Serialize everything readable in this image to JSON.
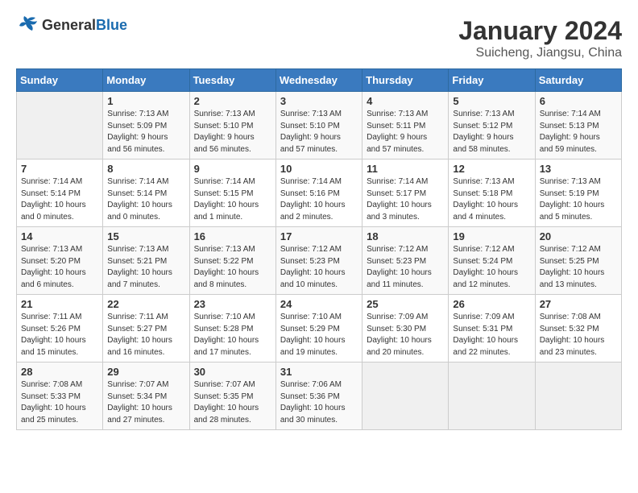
{
  "header": {
    "logo": {
      "general": "General",
      "blue": "Blue"
    },
    "title": "January 2024",
    "location": "Suicheng, Jiangsu, China"
  },
  "calendar": {
    "days_of_week": [
      "Sunday",
      "Monday",
      "Tuesday",
      "Wednesday",
      "Thursday",
      "Friday",
      "Saturday"
    ],
    "weeks": [
      [
        {
          "day": "",
          "info": ""
        },
        {
          "day": "1",
          "info": "Sunrise: 7:13 AM\nSunset: 5:09 PM\nDaylight: 9 hours\nand 56 minutes."
        },
        {
          "day": "2",
          "info": "Sunrise: 7:13 AM\nSunset: 5:10 PM\nDaylight: 9 hours\nand 56 minutes."
        },
        {
          "day": "3",
          "info": "Sunrise: 7:13 AM\nSunset: 5:10 PM\nDaylight: 9 hours\nand 57 minutes."
        },
        {
          "day": "4",
          "info": "Sunrise: 7:13 AM\nSunset: 5:11 PM\nDaylight: 9 hours\nand 57 minutes."
        },
        {
          "day": "5",
          "info": "Sunrise: 7:13 AM\nSunset: 5:12 PM\nDaylight: 9 hours\nand 58 minutes."
        },
        {
          "day": "6",
          "info": "Sunrise: 7:14 AM\nSunset: 5:13 PM\nDaylight: 9 hours\nand 59 minutes."
        }
      ],
      [
        {
          "day": "7",
          "info": "Sunrise: 7:14 AM\nSunset: 5:14 PM\nDaylight: 10 hours\nand 0 minutes."
        },
        {
          "day": "8",
          "info": "Sunrise: 7:14 AM\nSunset: 5:14 PM\nDaylight: 10 hours\nand 0 minutes."
        },
        {
          "day": "9",
          "info": "Sunrise: 7:14 AM\nSunset: 5:15 PM\nDaylight: 10 hours\nand 1 minute."
        },
        {
          "day": "10",
          "info": "Sunrise: 7:14 AM\nSunset: 5:16 PM\nDaylight: 10 hours\nand 2 minutes."
        },
        {
          "day": "11",
          "info": "Sunrise: 7:14 AM\nSunset: 5:17 PM\nDaylight: 10 hours\nand 3 minutes."
        },
        {
          "day": "12",
          "info": "Sunrise: 7:13 AM\nSunset: 5:18 PM\nDaylight: 10 hours\nand 4 minutes."
        },
        {
          "day": "13",
          "info": "Sunrise: 7:13 AM\nSunset: 5:19 PM\nDaylight: 10 hours\nand 5 minutes."
        }
      ],
      [
        {
          "day": "14",
          "info": "Sunrise: 7:13 AM\nSunset: 5:20 PM\nDaylight: 10 hours\nand 6 minutes."
        },
        {
          "day": "15",
          "info": "Sunrise: 7:13 AM\nSunset: 5:21 PM\nDaylight: 10 hours\nand 7 minutes."
        },
        {
          "day": "16",
          "info": "Sunrise: 7:13 AM\nSunset: 5:22 PM\nDaylight: 10 hours\nand 8 minutes."
        },
        {
          "day": "17",
          "info": "Sunrise: 7:12 AM\nSunset: 5:23 PM\nDaylight: 10 hours\nand 10 minutes."
        },
        {
          "day": "18",
          "info": "Sunrise: 7:12 AM\nSunset: 5:23 PM\nDaylight: 10 hours\nand 11 minutes."
        },
        {
          "day": "19",
          "info": "Sunrise: 7:12 AM\nSunset: 5:24 PM\nDaylight: 10 hours\nand 12 minutes."
        },
        {
          "day": "20",
          "info": "Sunrise: 7:12 AM\nSunset: 5:25 PM\nDaylight: 10 hours\nand 13 minutes."
        }
      ],
      [
        {
          "day": "21",
          "info": "Sunrise: 7:11 AM\nSunset: 5:26 PM\nDaylight: 10 hours\nand 15 minutes."
        },
        {
          "day": "22",
          "info": "Sunrise: 7:11 AM\nSunset: 5:27 PM\nDaylight: 10 hours\nand 16 minutes."
        },
        {
          "day": "23",
          "info": "Sunrise: 7:10 AM\nSunset: 5:28 PM\nDaylight: 10 hours\nand 17 minutes."
        },
        {
          "day": "24",
          "info": "Sunrise: 7:10 AM\nSunset: 5:29 PM\nDaylight: 10 hours\nand 19 minutes."
        },
        {
          "day": "25",
          "info": "Sunrise: 7:09 AM\nSunset: 5:30 PM\nDaylight: 10 hours\nand 20 minutes."
        },
        {
          "day": "26",
          "info": "Sunrise: 7:09 AM\nSunset: 5:31 PM\nDaylight: 10 hours\nand 22 minutes."
        },
        {
          "day": "27",
          "info": "Sunrise: 7:08 AM\nSunset: 5:32 PM\nDaylight: 10 hours\nand 23 minutes."
        }
      ],
      [
        {
          "day": "28",
          "info": "Sunrise: 7:08 AM\nSunset: 5:33 PM\nDaylight: 10 hours\nand 25 minutes."
        },
        {
          "day": "29",
          "info": "Sunrise: 7:07 AM\nSunset: 5:34 PM\nDaylight: 10 hours\nand 27 minutes."
        },
        {
          "day": "30",
          "info": "Sunrise: 7:07 AM\nSunset: 5:35 PM\nDaylight: 10 hours\nand 28 minutes."
        },
        {
          "day": "31",
          "info": "Sunrise: 7:06 AM\nSunset: 5:36 PM\nDaylight: 10 hours\nand 30 minutes."
        },
        {
          "day": "",
          "info": ""
        },
        {
          "day": "",
          "info": ""
        },
        {
          "day": "",
          "info": ""
        }
      ]
    ]
  }
}
